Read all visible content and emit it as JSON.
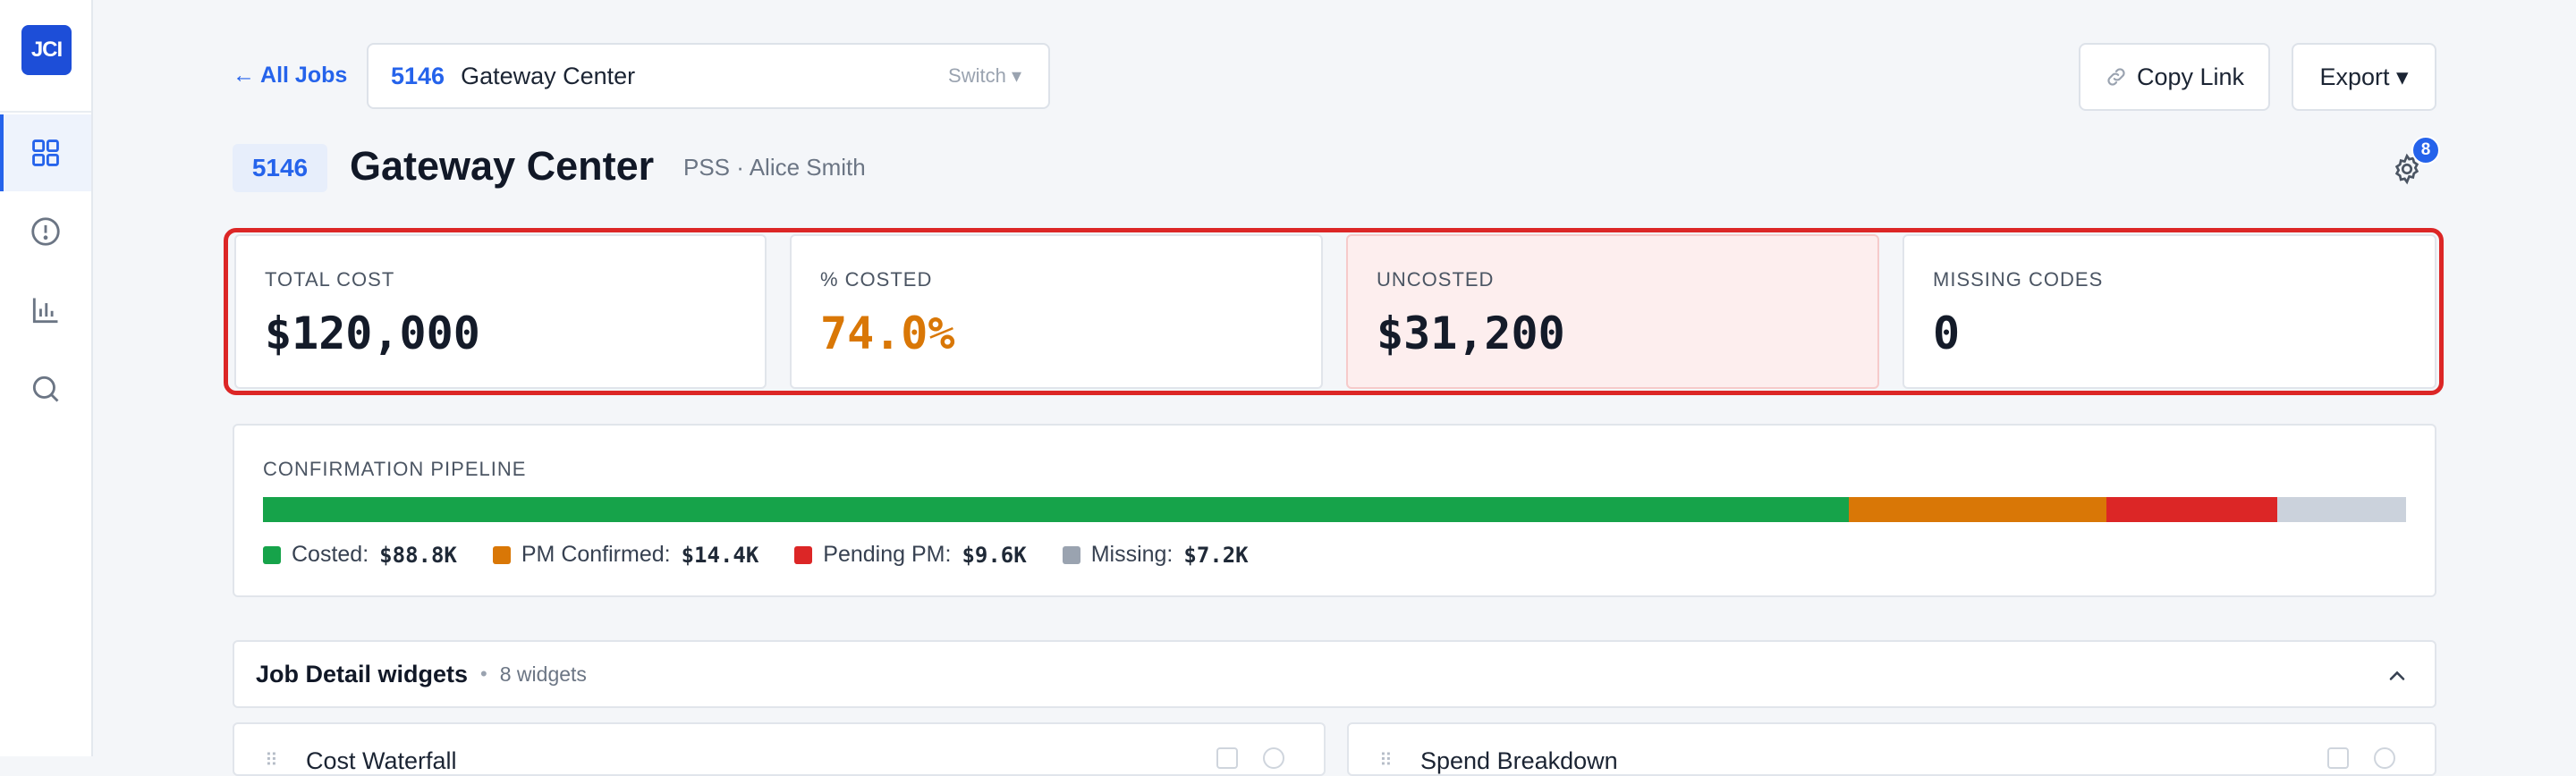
{
  "sidebar": {
    "logo": "JCI",
    "items": [
      {
        "name": "dashboard-icon",
        "active": true
      },
      {
        "name": "alert-icon",
        "active": false
      },
      {
        "name": "chart-icon",
        "active": false
      },
      {
        "name": "search-icon",
        "active": false
      }
    ]
  },
  "topbar": {
    "back_label": "← All Jobs",
    "job_number": "5146",
    "job_name": "Gateway Center",
    "switch_label": "Switch ▾",
    "copy_link_label": "Copy Link",
    "export_label": "Export ▾"
  },
  "header": {
    "job_number": "5146",
    "title": "Gateway Center",
    "subtitle": "PSS · Alice Smith",
    "settings_badge": "8"
  },
  "kpis": [
    {
      "label": "TOTAL COST",
      "value": "$120,000"
    },
    {
      "label": "% COSTED",
      "value": "74.0%"
    },
    {
      "label": "UNCOSTED",
      "value": "$31,200"
    },
    {
      "label": "MISSING CODES",
      "value": "0"
    }
  ],
  "pipeline": {
    "title": "CONFIRMATION PIPELINE",
    "segments": [
      {
        "label": "Costed:",
        "value": "$88.8K",
        "amount": 88.8,
        "color": "#16a34a"
      },
      {
        "label": "PM Confirmed:",
        "value": "$14.4K",
        "amount": 14.4,
        "color": "#d97706"
      },
      {
        "label": "Pending PM:",
        "value": "$9.6K",
        "amount": 9.6,
        "color": "#dc2626"
      },
      {
        "label": "Missing:",
        "value": "$7.2K",
        "amount": 7.2,
        "color": "#cbd2dc"
      }
    ]
  },
  "widgets": {
    "title": "Job Detail widgets",
    "count": "8 widgets",
    "items": [
      "Cost Waterfall",
      "Spend Breakdown"
    ]
  },
  "colors": {
    "accent": "#2563eb",
    "highlight_frame": "#dc2626",
    "alert_bg": "#fdeeee"
  }
}
